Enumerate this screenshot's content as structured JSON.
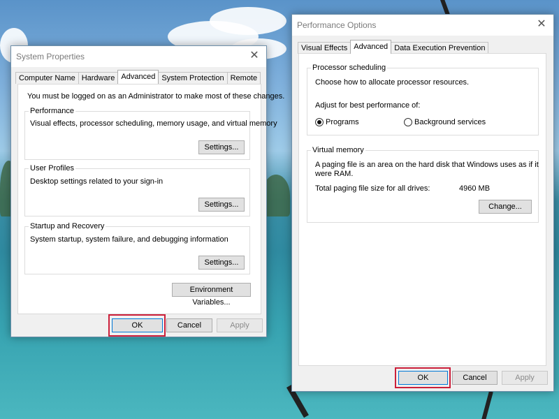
{
  "system_properties": {
    "title": "System Properties",
    "close_glyph": "✕",
    "tabs": [
      "Computer Name",
      "Hardware",
      "Advanced",
      "System Protection",
      "Remote"
    ],
    "active_tab": "Advanced",
    "admin_note": "You must be logged on as an Administrator to make most of these changes.",
    "performance": {
      "label": "Performance",
      "description": "Visual effects, processor scheduling, memory usage, and virtual memory",
      "settings_label": "Settings..."
    },
    "user_profiles": {
      "label": "User Profiles",
      "description": "Desktop settings related to your sign-in",
      "settings_label": "Settings..."
    },
    "startup_recovery": {
      "label": "Startup and Recovery",
      "description": "System startup, system failure, and debugging information",
      "settings_label": "Settings..."
    },
    "env_vars_label": "Environment Variables...",
    "ok_label": "OK",
    "cancel_label": "Cancel",
    "apply_label": "Apply"
  },
  "performance_options": {
    "title": "Performance Options",
    "close_glyph": "✕",
    "tabs": [
      "Visual Effects",
      "Advanced",
      "Data Execution Prevention"
    ],
    "active_tab": "Advanced",
    "processor_scheduling": {
      "label": "Processor scheduling",
      "description": "Choose how to allocate processor resources.",
      "adjust_label": "Adjust for best performance of:",
      "options": [
        "Programs",
        "Background services"
      ],
      "selected": "Programs"
    },
    "virtual_memory": {
      "label": "Virtual memory",
      "description_line1": "A paging file is an area on the hard disk that Windows uses as if it",
      "description_line2": "were RAM.",
      "total_label": "Total paging file size for all drives:",
      "total_value": "4960 MB",
      "change_label": "Change..."
    },
    "ok_label": "OK",
    "cancel_label": "Cancel",
    "apply_label": "Apply"
  },
  "colors": {
    "highlight": "#cc1f3a",
    "accent": "#0078d7"
  }
}
